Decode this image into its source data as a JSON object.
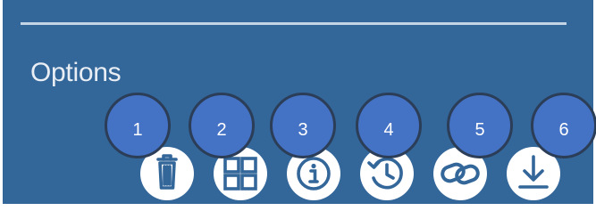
{
  "panel": {
    "title": "Options",
    "background": "#336699"
  },
  "toolbar": {
    "buttons": [
      {
        "id": "delete",
        "icon": "trash-icon"
      },
      {
        "id": "layout",
        "icon": "grid-icon"
      },
      {
        "id": "info",
        "icon": "info-icon"
      },
      {
        "id": "history",
        "icon": "history-icon"
      },
      {
        "id": "link",
        "icon": "link-icon"
      },
      {
        "id": "download",
        "icon": "download-icon"
      }
    ]
  },
  "callouts": [
    {
      "label": "1",
      "color": "#4472c4"
    },
    {
      "label": "2",
      "color": "#4472c4"
    },
    {
      "label": "3",
      "color": "#4472c4"
    },
    {
      "label": "4",
      "color": "#4472c4"
    },
    {
      "label": "5",
      "color": "#4472c4"
    },
    {
      "label": "6",
      "color": "#4472c4"
    }
  ]
}
